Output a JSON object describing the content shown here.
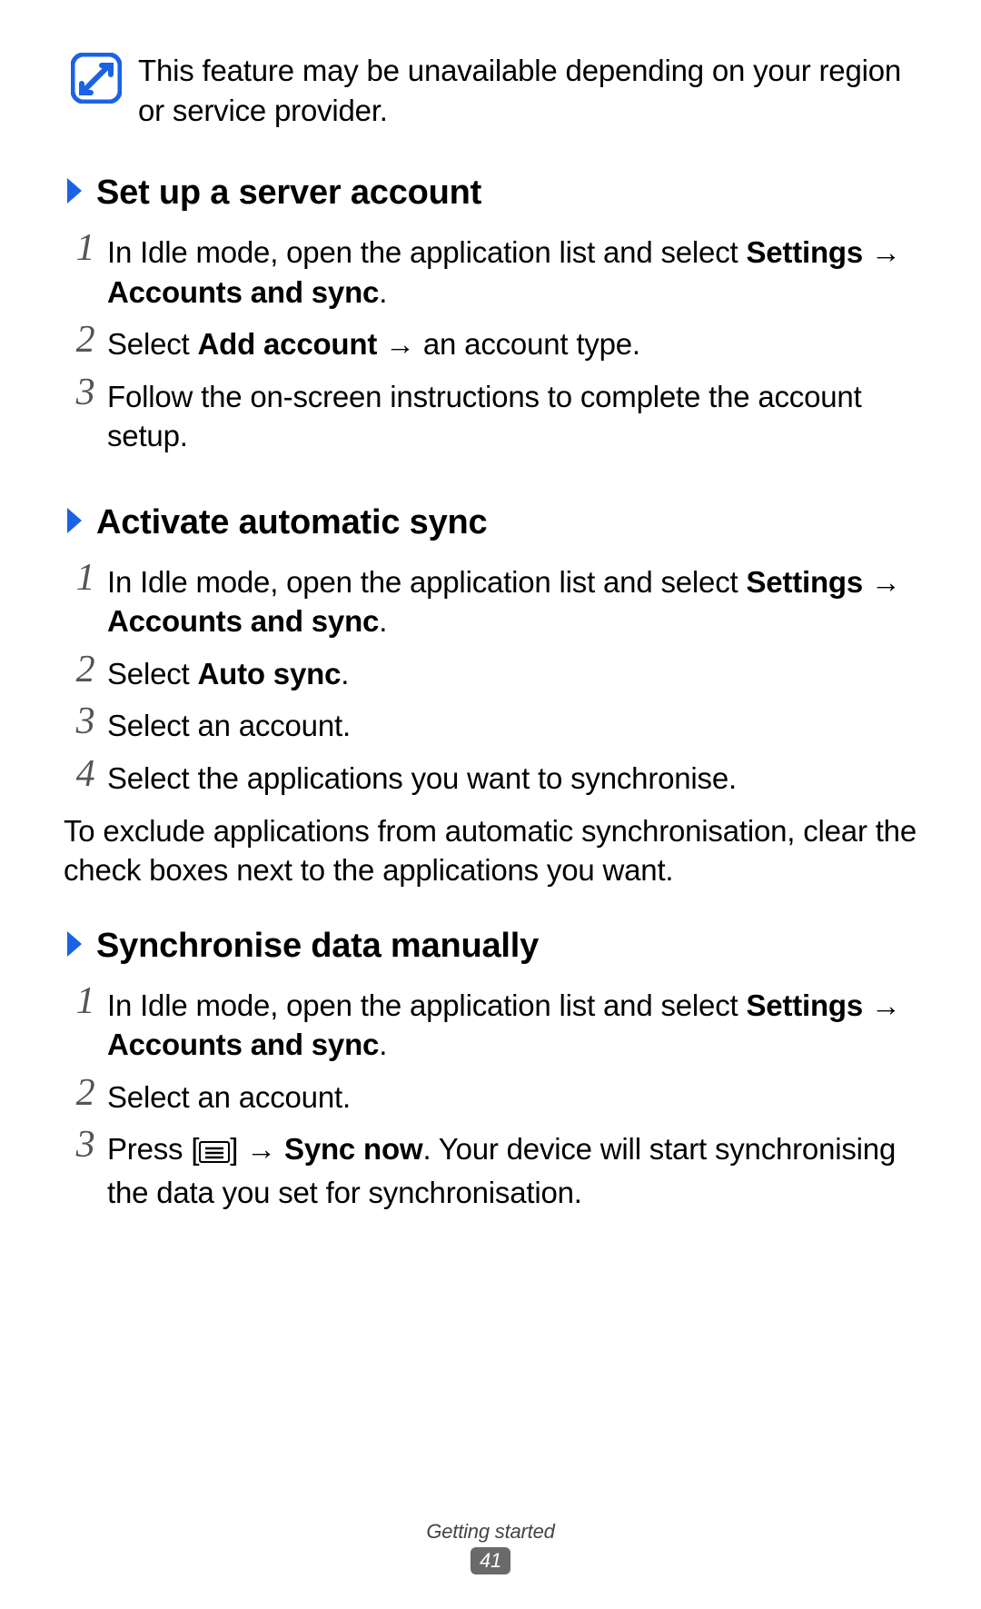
{
  "note": {
    "text": "This feature may be unavailable depending on your region or service provider."
  },
  "arrow": "→",
  "sections": {
    "s1": {
      "title": "Set up a server account",
      "steps": {
        "n1": "1",
        "t1a": "In Idle mode, open the application list and select ",
        "t1b": "Settings",
        "t1c": "Accounts and sync",
        "t1d": ".",
        "n2": "2",
        "t2a": "Select ",
        "t2b": "Add account",
        "t2c": " an account type.",
        "n3": "3",
        "t3": "Follow the on-screen instructions to complete the account setup."
      }
    },
    "s2": {
      "title": "Activate automatic sync",
      "steps": {
        "n1": "1",
        "t1a": "In Idle mode, open the application list and select ",
        "t1b": "Settings",
        "t1c": "Accounts and sync",
        "t1d": ".",
        "n2": "2",
        "t2a": "Select ",
        "t2b": "Auto sync",
        "t2c": ".",
        "n3": "3",
        "t3": "Select an account.",
        "n4": "4",
        "t4": "Select the applications you want to synchronise."
      },
      "para": "To exclude applications from automatic synchronisation, clear the check boxes next to the applications you want."
    },
    "s3": {
      "title": "Synchronise data manually",
      "steps": {
        "n1": "1",
        "t1a": "In Idle mode, open the application list and select ",
        "t1b": "Settings",
        "t1c": "Accounts and sync",
        "t1d": ".",
        "n2": "2",
        "t2": "Select an account.",
        "n3": "3",
        "t3a": "Press [",
        "t3b": "] ",
        "t3c": "Sync now",
        "t3d": ". Your device will start synchronising the data you set for synchronisation."
      }
    }
  },
  "footer": {
    "section": "Getting started",
    "page": "41"
  },
  "colors": {
    "accent": "#1a62e6"
  }
}
